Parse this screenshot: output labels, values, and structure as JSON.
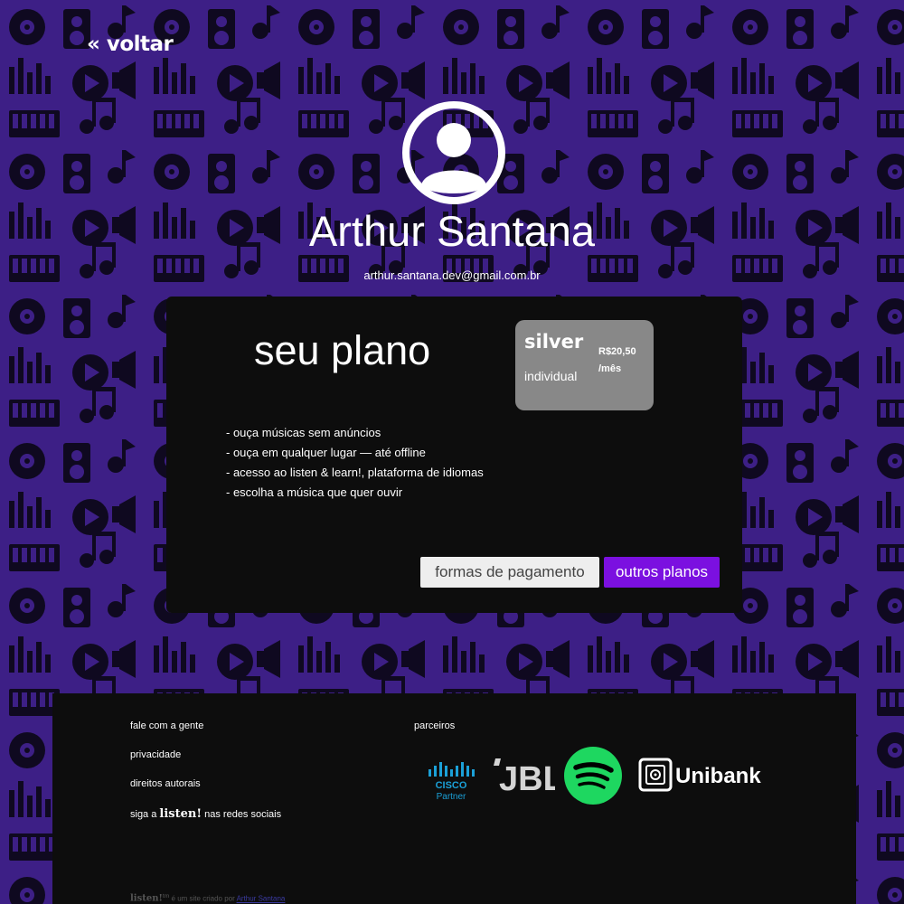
{
  "nav": {
    "back_label": "« voltar"
  },
  "profile": {
    "name": "Arthur Santana",
    "email": "arthur.santana.dev@gmail.com.br",
    "avatar_icon": "user-circle-icon"
  },
  "plan": {
    "title": "seu plano",
    "name": "silver",
    "type": "individual",
    "price": "R$20,50",
    "period": "/mês",
    "features": [
      "- ouça músicas sem anúncios",
      "- ouça em qualquer lugar — até offline",
      "- acesso ao listen & learn!, plataforma de idiomas",
      "- escolha a música que quer ouvir"
    ],
    "buttons": {
      "payment": "formas de pagamento",
      "other_plans": "outros planos"
    }
  },
  "footer": {
    "links": {
      "contact": "fale com a gente",
      "privacy": "privacidade",
      "copyright": "direitos autorais",
      "social_prefix": "siga a",
      "social_brand": "listen!",
      "social_suffix": "nas redes sociais"
    },
    "partners": {
      "heading": "parceiros",
      "cisco_name": "CISCO",
      "cisco_sub": "Partner",
      "jbl": "JBL",
      "unibank": "Unibank"
    },
    "credit": {
      "brand": "listen!",
      "tm": "tm",
      "text": "é um site criado por",
      "author": "Arthur Santana"
    }
  },
  "colors": {
    "background": "#3d1f86",
    "card": "#0d0d0d",
    "badge": "#888888",
    "accent": "#7b10e0",
    "spotify": "#1ed760",
    "cisco": "#1ba0d7"
  }
}
